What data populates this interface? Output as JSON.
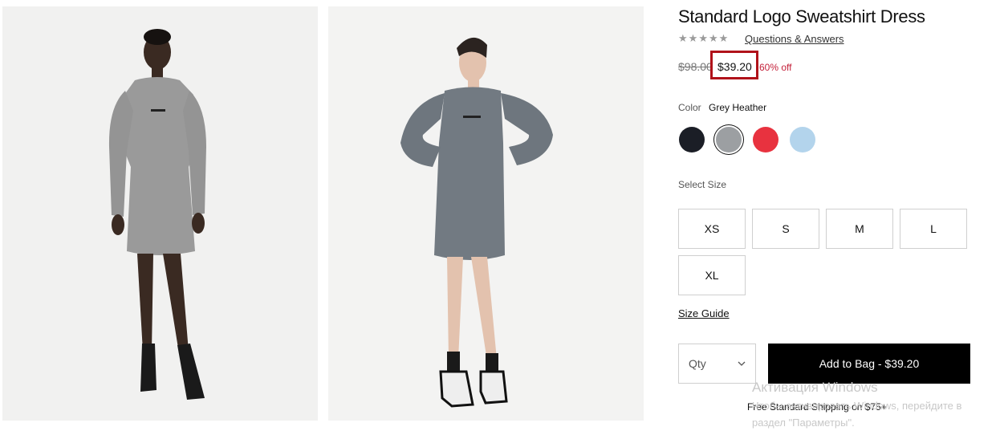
{
  "product": {
    "title": "Standard Logo Sweatshirt Dress",
    "rating_stars": 0,
    "qa_link": "Questions & Answers",
    "original_price": "$98.00",
    "sale_price": "$39.20",
    "discount": "60% off"
  },
  "color": {
    "label": "Color",
    "selected": "Grey Heather",
    "swatches": [
      {
        "name": "black-swatch",
        "hex": "#1b1e26"
      },
      {
        "name": "grey-heather-swatch",
        "hex": "#9c9fa2",
        "selected": true
      },
      {
        "name": "red-swatch",
        "hex": "#e8323f"
      },
      {
        "name": "light-blue-swatch",
        "hex": "#b3d4ec"
      }
    ]
  },
  "size": {
    "label": "Select Size",
    "options": [
      "XS",
      "S",
      "M",
      "L",
      "XL"
    ],
    "guide": "Size Guide"
  },
  "purchase": {
    "qty_placeholder": "Qty",
    "add_to_bag": "Add to Bag - $39.20",
    "shipping": "Free Standard Shipping on $75+"
  },
  "os_watermark": {
    "title": "Активация Windows",
    "line1": "Чтобы активировать Windows, перейдите в",
    "line2": "раздел \"Параметры\"."
  },
  "colors": {
    "sale_red": "#c4213a",
    "highlight_box": "#b0121a",
    "button_black": "#000000"
  }
}
